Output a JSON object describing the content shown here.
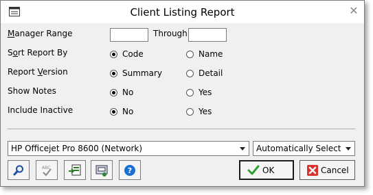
{
  "window": {
    "title": "Client Listing Report"
  },
  "fields": {
    "manager_range": {
      "label_pre": "",
      "label_u": "M",
      "label_post": "anager Range",
      "from_value": "",
      "through_label": "Through",
      "to_value": ""
    },
    "sort_report_by": {
      "label_pre": "S",
      "label_u": "o",
      "label_post": "rt Report By",
      "options": [
        "Code",
        "Name"
      ],
      "selected": "Code"
    },
    "report_version": {
      "label_pre": "Report ",
      "label_u": "V",
      "label_post": "ersion",
      "options": [
        "Summary",
        "Detail"
      ],
      "selected": "Summary"
    },
    "show_notes": {
      "label": "Show Notes",
      "options": [
        "No",
        "Yes"
      ],
      "selected": "No"
    },
    "include_inactive": {
      "label": "Include Inactive",
      "options": [
        "No",
        "Yes"
      ],
      "selected": "No"
    }
  },
  "printer": {
    "value": "HP Officejet Pro 8600 (Network)"
  },
  "tray": {
    "value": "Automatically Select"
  },
  "toolbar": [
    "search-icon",
    "spellcheck-icon",
    "export-icon",
    "print-setup-icon",
    "help-icon"
  ],
  "buttons": {
    "ok_label": "OK",
    "cancel_label": "Cancel"
  },
  "colors": {
    "ok_check": "#2e9e2e",
    "cancel_x": "#d9342b",
    "help_blue": "#1a6fd6"
  }
}
